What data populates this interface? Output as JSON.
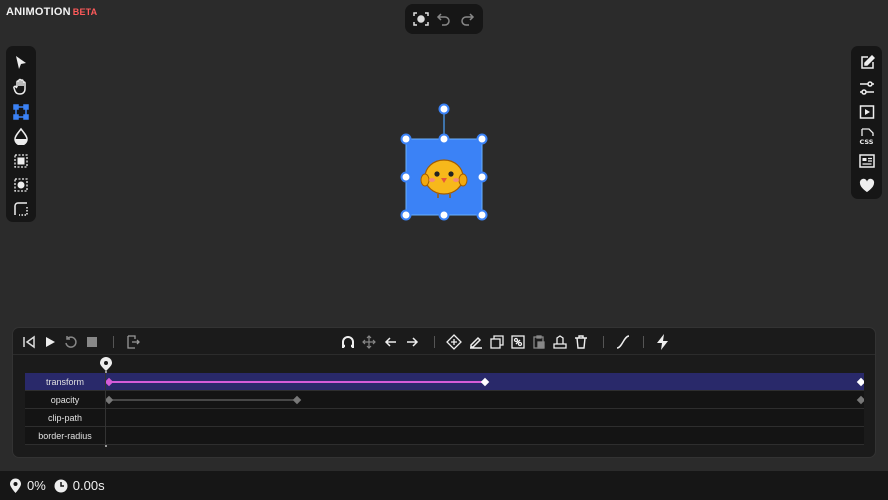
{
  "app": {
    "name": "ANIMOTION",
    "badge": "BETA"
  },
  "top_toolbar": {
    "items": [
      "capture-icon",
      "undo-icon",
      "redo-icon"
    ]
  },
  "left_toolbar": {
    "items": [
      "select-icon",
      "hand-icon",
      "resize-icon",
      "fill-icon",
      "selection-inner-icon",
      "selection-center-icon",
      "corner-radius-icon"
    ],
    "active": "resize-icon"
  },
  "right_toolbar": {
    "items": [
      "edit-icon",
      "sliders-icon",
      "play-preview-icon",
      "css-icon",
      "article-icon",
      "heart-icon"
    ]
  },
  "timeline": {
    "tracks": [
      {
        "label": "transform",
        "keyframes_percent": [
          0,
          50,
          100
        ]
      },
      {
        "label": "opacity",
        "keyframes_percent": [
          0,
          25,
          100
        ]
      },
      {
        "label": "clip-path",
        "keyframes_percent": []
      },
      {
        "label": "border-radius",
        "keyframes_percent": []
      }
    ],
    "active_track": "transform"
  },
  "status": {
    "progress": "0%",
    "time": "0.00s"
  },
  "colors": {
    "accent": "#3b82f6",
    "keyframe_active": "#d45cd8",
    "brand_badge": "#ff5a5a",
    "selected_row": "#29296a"
  }
}
